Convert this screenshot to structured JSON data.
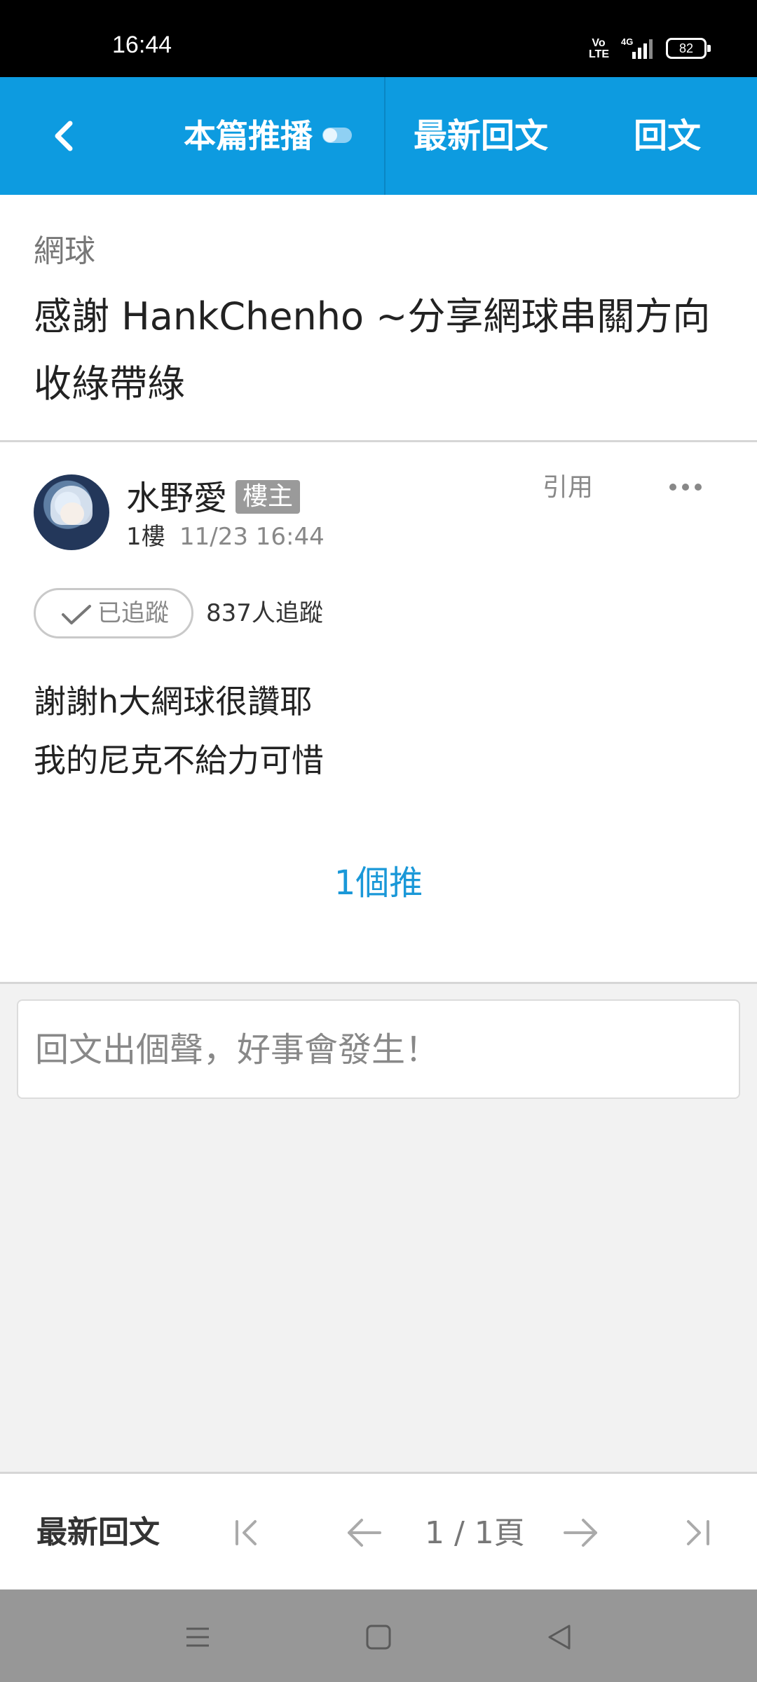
{
  "status_bar": {
    "time": "16:44",
    "volte": "Vo\nLTE",
    "network": "4G",
    "battery": "82"
  },
  "app_bar": {
    "push_tab": "本篇推播",
    "latest_tab": "最新回文",
    "reply_tab": "回文"
  },
  "thread": {
    "board": "網球",
    "title": "感謝 HankChenho ~分享網球串關方向收綠帶綠"
  },
  "post": {
    "author": "水野愛",
    "badge": "樓主",
    "floor": "1樓",
    "date": "11/23 16:44",
    "quote": "引用",
    "follow_label": "已追蹤",
    "followers": "837人追蹤",
    "content": "謝謝h大網球很讚耶\n我的尼克不給力可惜",
    "likes": "1個推"
  },
  "reply_box": {
    "placeholder": "回文出個聲，好事會發生！"
  },
  "bottom_bar": {
    "latest": "最新回文",
    "page": "1 / 1頁"
  },
  "icons": {
    "back": "chevron-left-icon",
    "toggle": "toggle-icon",
    "more": "more-dots-icon",
    "check": "check-icon",
    "first": "first-page-icon",
    "prev": "arrow-left-icon",
    "next": "arrow-right-icon",
    "last": "last-page-icon"
  },
  "colors": {
    "app_bar": "#0d9be0",
    "link": "#1a98d8",
    "badge": "#9a9a9a"
  }
}
